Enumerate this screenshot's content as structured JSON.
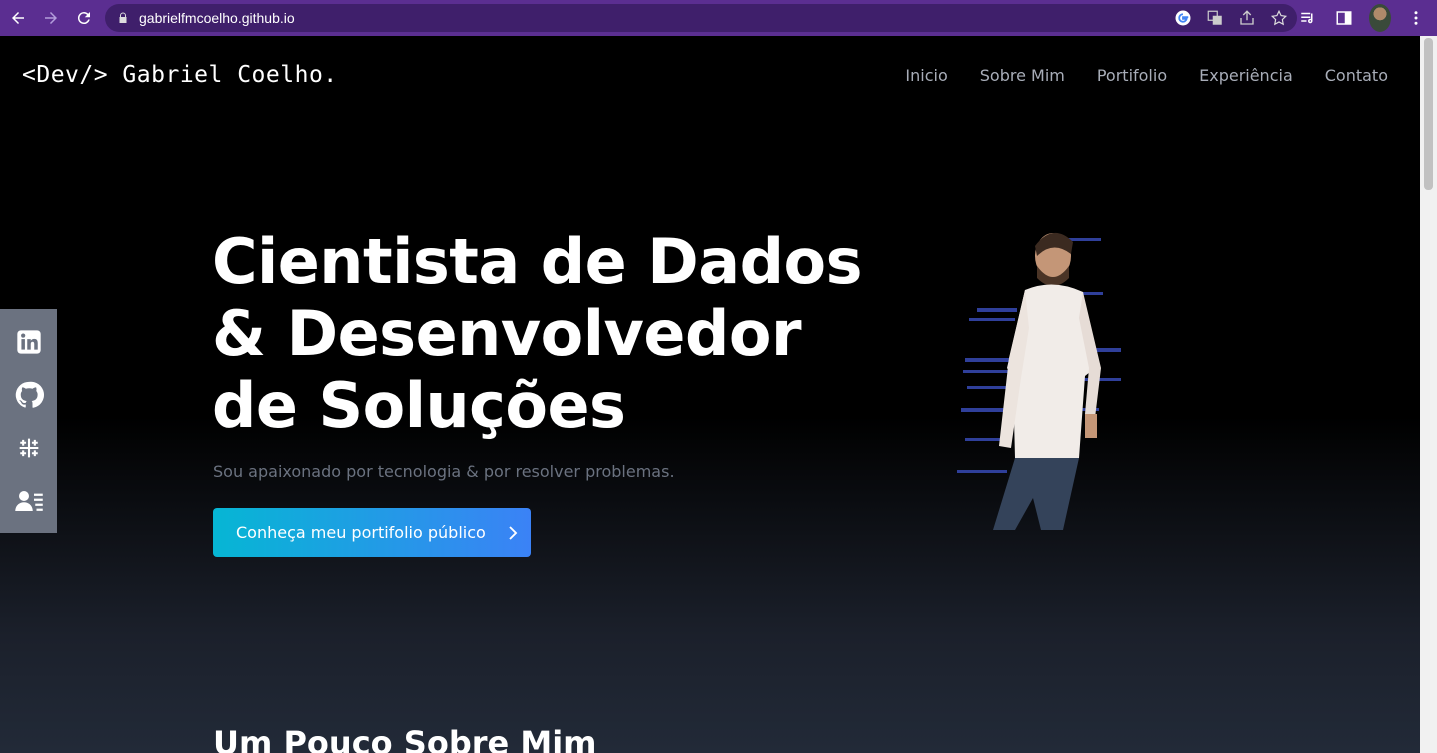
{
  "browser": {
    "url": "gabrielfmcoelho.github.io"
  },
  "header": {
    "logo": "<Dev/> Gabriel Coelho.",
    "nav": [
      {
        "label": "Inicio"
      },
      {
        "label": "Sobre Mim"
      },
      {
        "label": "Portifolio"
      },
      {
        "label": "Experiência"
      },
      {
        "label": "Contato"
      }
    ]
  },
  "hero": {
    "title_line1": "Cientista de Dados",
    "title_line2": "& Desenvolvedor",
    "title_line3": "de Soluções",
    "subtitle": "Sou apaixonado por tecnologia & por resolver problemas.",
    "cta_label": "Conheça meu portifolio público"
  },
  "social": {
    "icons": [
      "linkedin-icon",
      "github-icon",
      "tableau-icon",
      "resume-icon"
    ]
  },
  "section": {
    "title": "Um Pouco Sobre Mim"
  },
  "colors": {
    "chrome": "#5b2e91",
    "accent_start": "#06b6d4",
    "accent_end": "#3b82f6",
    "sidebar": "#6b7280"
  }
}
